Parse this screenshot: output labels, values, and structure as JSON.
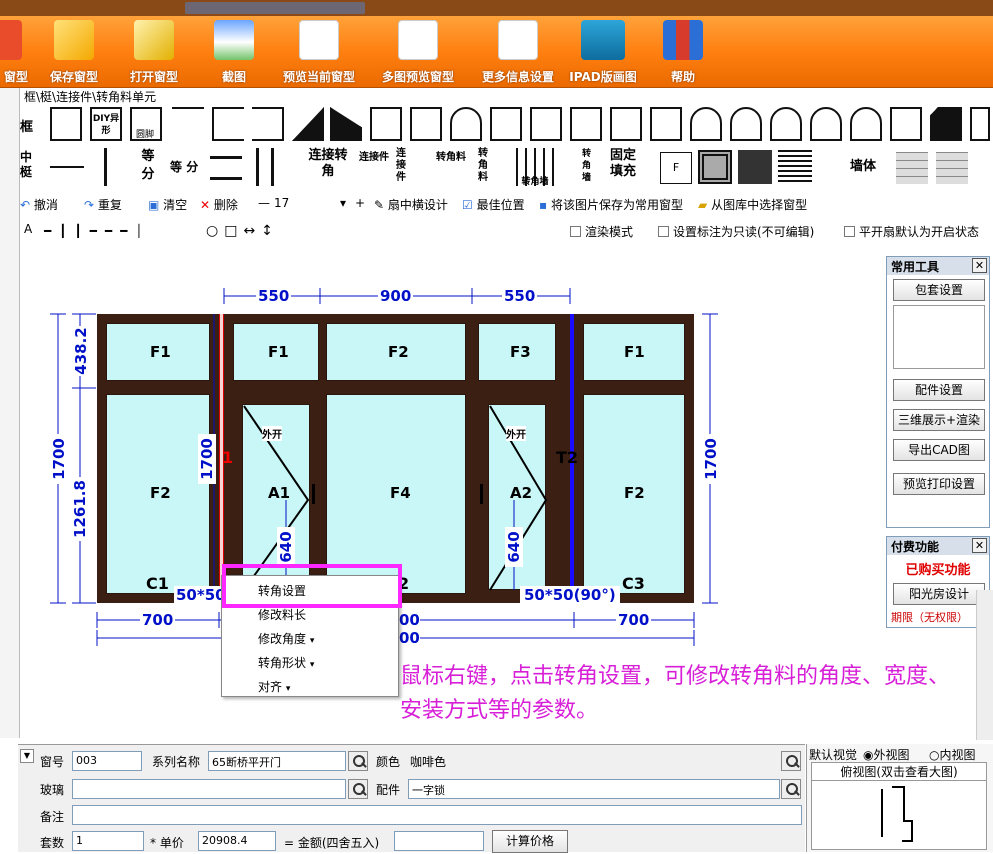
{
  "ribbon": {
    "buttons": [
      {
        "label": "窗型",
        "icon": "window-icon"
      },
      {
        "label": "保存窗型",
        "icon": "save-window-icon"
      },
      {
        "label": "打开窗型",
        "icon": "open-window-icon"
      },
      {
        "label": "截图",
        "icon": "screenshot-icon"
      },
      {
        "label": "预览当前窗型",
        "icon": "preview-icon"
      },
      {
        "label": "多图预览窗型",
        "icon": "multi-preview-icon"
      },
      {
        "label": "更多信息设置",
        "icon": "settings-doc-icon"
      },
      {
        "label": "IPAD版画图",
        "icon": "ipad-icon"
      },
      {
        "label": "帮助",
        "icon": "books-icon"
      }
    ]
  },
  "breadcrumb": "框\\梃\\连接件\\转角料单元",
  "palette": {
    "row1_label": "框",
    "row2_label": "中梃",
    "diy_label": "DIY异形",
    "round_label": "圆脚",
    "connector_label": "连接转角",
    "connector2": "连接件",
    "connector3": "连接件",
    "corner1": "转角料",
    "corner2": "转角料",
    "corner_wall": "转角墙",
    "corner_wall2": "转角墙",
    "fixed_fill": "固定填充",
    "f_label": "F",
    "wall_label": "墙体",
    "equal_label": "等",
    "equal_label2": "等",
    "div_label": "分",
    "div_label2": "分"
  },
  "toolbar": {
    "undo": "撤消",
    "redo": "重复",
    "clear": "清空",
    "delete": "删除",
    "minus": "—",
    "value": "17",
    "plus": "+",
    "sash_design": "扇中横设计",
    "best_pos": "最佳位置",
    "save_common": "将该图片保存为常用窗型",
    "choose_lib": "从图库中选择窗型"
  },
  "drawtools": {
    "text": "A",
    "render_mode": "渲染模式",
    "readonly_label": "设置标注为只读(不可编辑)",
    "default_open": "平开扇默认为开启状态"
  },
  "drawing": {
    "top_dims": [
      "550",
      "900",
      "550"
    ],
    "left_dims": [
      "438.2",
      "1261.8"
    ],
    "left_total": "1700",
    "right_total": "1700",
    "inner_1700": "1700",
    "bottom_dims": [
      "700",
      "700"
    ],
    "bottom_mid": [
      "00",
      "00"
    ],
    "panes_top": [
      "F1",
      "F1",
      "F2",
      "F3",
      "F1"
    ],
    "panes_bottom": [
      "F2",
      "A1",
      "F4",
      "A2",
      "F2"
    ],
    "open_label1": "外开",
    "open_label2": "外开",
    "handle_dim1": "640",
    "handle_dim2": "640",
    "c1": "C1",
    "c3": "C3",
    "t2": "T2",
    "red_1": "1",
    "corner_left": "50*50",
    "corner_right": "50*50(90°)",
    "c2_partial": "2"
  },
  "context_menu": {
    "items": [
      {
        "label": "转角设置",
        "submenu": false
      },
      {
        "label": "修改料长",
        "submenu": false
      },
      {
        "label": "修改角度",
        "submenu": true
      },
      {
        "label": "转角形状",
        "submenu": true
      },
      {
        "label": "对齐",
        "submenu": true
      }
    ]
  },
  "annotation": "鼠标右键，点击转角设置，可修改转角料的角度、宽度、安装方式等的参数。",
  "common_tools": {
    "title": "常用工具",
    "buttons": [
      "包套设置",
      "配件设置",
      "三维展示+渲染",
      "导出CAD图",
      "预览打印设置"
    ]
  },
  "paid": {
    "title": "付费功能",
    "purchased": "已购买功能",
    "sunroom": "阳光房设计",
    "expiry": "期限（无权限）"
  },
  "form": {
    "window_no_label": "窗号",
    "window_no": "003",
    "series_label": "系列名称",
    "series": "65断桥平开门",
    "color_label": "颜色",
    "color": "咖啡色",
    "glass_label": "玻璃",
    "glass": "",
    "fitting_label": "配件",
    "fitting": "一字锁",
    "remark_label": "备注",
    "sets_label": "套数",
    "sets": "1",
    "price_label": "* 单价",
    "price": "20908.4",
    "total_label": "= 金额(四舍五入)",
    "calc_button": "计算价格"
  },
  "view": {
    "default_label": "默认视觉",
    "outer": "外视图",
    "inner": "内视图",
    "top_view": "俯视图(双击查看大图)"
  },
  "colors": {
    "ribbon": "#ff8a1c",
    "frame": "#3a1f12",
    "glass": "#c9f7f7",
    "dimension": "#0010c8",
    "highlight": "#ff27ff",
    "annotation": "#d81fd8",
    "paid_red": "#e00000"
  }
}
